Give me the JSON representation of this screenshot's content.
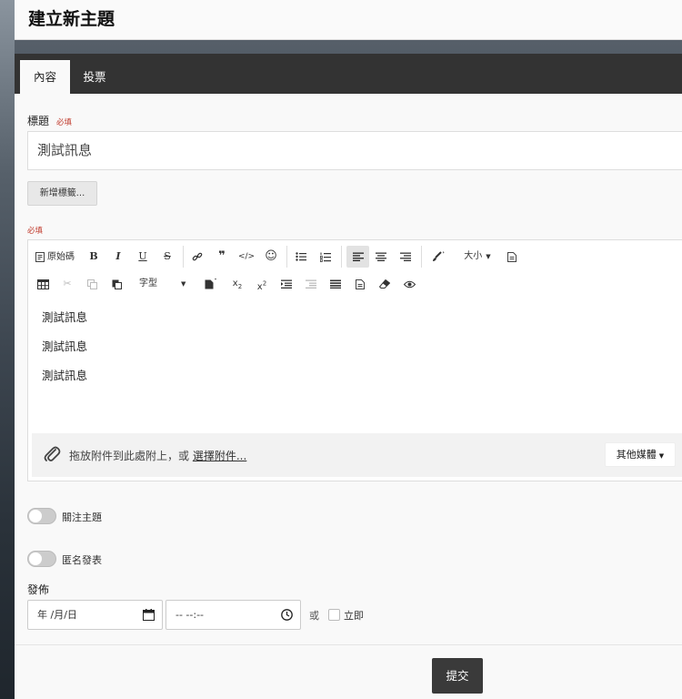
{
  "page": {
    "title": "建立新主題"
  },
  "tabs": [
    {
      "label": "內容",
      "active": true
    },
    {
      "label": "投票",
      "active": false
    }
  ],
  "form": {
    "title_label": "標題",
    "required": "必填",
    "title_value": "測試訊息",
    "add_tag": "新增標籤...",
    "content_required": "必填"
  },
  "toolbar": {
    "source": "原始碼",
    "font_label": "字型",
    "size_label": "大小",
    "bold": "B",
    "italic": "I",
    "underline": "U",
    "strike": "S",
    "emoji": "☺",
    "code": "</>",
    "quote": "❞"
  },
  "editor": {
    "lines": [
      "測試訊息",
      "測試訊息",
      "測試訊息"
    ]
  },
  "attach": {
    "text": "拖放附件到此處附上，或",
    "link": "選擇附件...",
    "media": "其他媒體"
  },
  "options": {
    "watch": "關注主題",
    "anonymous": "匿名發表"
  },
  "publish": {
    "label": "發佈",
    "date_placeholder": "年 /月/日",
    "time_placeholder": "-- --:--",
    "or": "或",
    "now": "立即"
  },
  "submit": "提交"
}
